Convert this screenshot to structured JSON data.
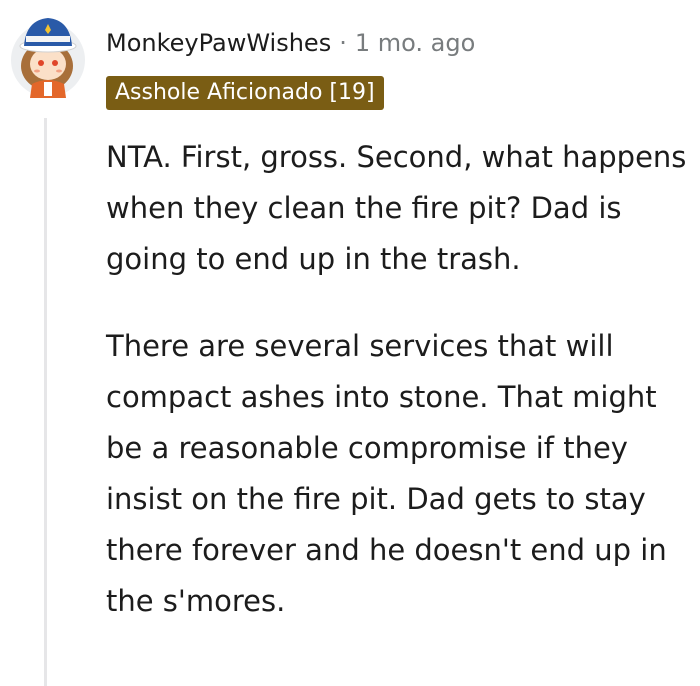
{
  "comment": {
    "author": "MonkeyPawWishes",
    "separator": "·",
    "timestamp": "1 mo. ago",
    "flair": "Asshole Aficionado [19]",
    "paragraphs": [
      "NTA. First, gross. Second, what happens when they clean the fire pit? Dad is going to end up in the trash.",
      "There are several services that will compact ashes into stone. That might be a reasonable compromise if they insist on the fire pit. Dad gets to stay there forever and he doesn't end up in the s'mores."
    ]
  },
  "colors": {
    "flair_background": "#7a5d14",
    "flair_text": "#ffffff",
    "username": "#1c1c1c",
    "meta_gray": "#787c7e",
    "body_text": "#1c1c1c",
    "thread_line": "#e6e6e8"
  },
  "icons": {
    "avatar": "user-avatar-icon"
  }
}
